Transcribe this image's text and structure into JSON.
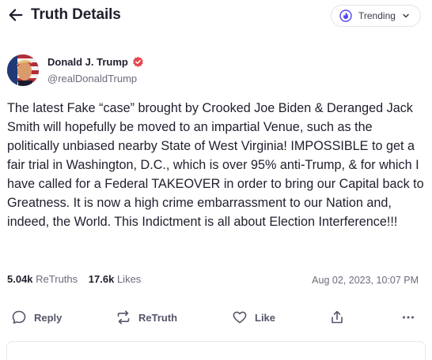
{
  "header": {
    "title": "Truth Details",
    "trending_label": "Trending"
  },
  "author": {
    "name": "Donald J. Trump",
    "handle": "@realDonaldTrump"
  },
  "post": {
    "text": "The latest Fake “case” brought by Crooked Joe Biden & Deranged Jack Smith will hopefully be moved to an impartial Venue, such as the politically unbiased nearby State of West Virginia! IMPOSSIBLE to get a fair trial in Washington, D.C., which is over 95% anti-Trump, & for which I have called for a Federal TAKEOVER in order to bring our Capital back to Greatness. It is now a high crime embarrassment to our Nation and, indeed, the World. This Indictment is all about Election Interference!!!",
    "retruths_count": "5.04k",
    "retruths_label": "ReTruths",
    "likes_count": "17.6k",
    "likes_label": "Likes",
    "date": "Aug 02, 2023, 10:07 PM"
  },
  "actions": {
    "reply_label": "Reply",
    "retruth_label": "ReTruth",
    "like_label": "Like"
  },
  "colors": {
    "accent": "#5448ee",
    "text": "#1f1f2e",
    "muted": "#6b6c7a"
  },
  "icons": {
    "back": "arrow-left-icon",
    "trending": "flame-icon",
    "chevron": "chevron-down-icon",
    "verified": "verified-badge-icon",
    "reply": "speech-bubble-icon",
    "retruth": "retruth-arrows-icon",
    "like": "heart-icon",
    "share": "share-icon",
    "more": "ellipsis-icon"
  }
}
